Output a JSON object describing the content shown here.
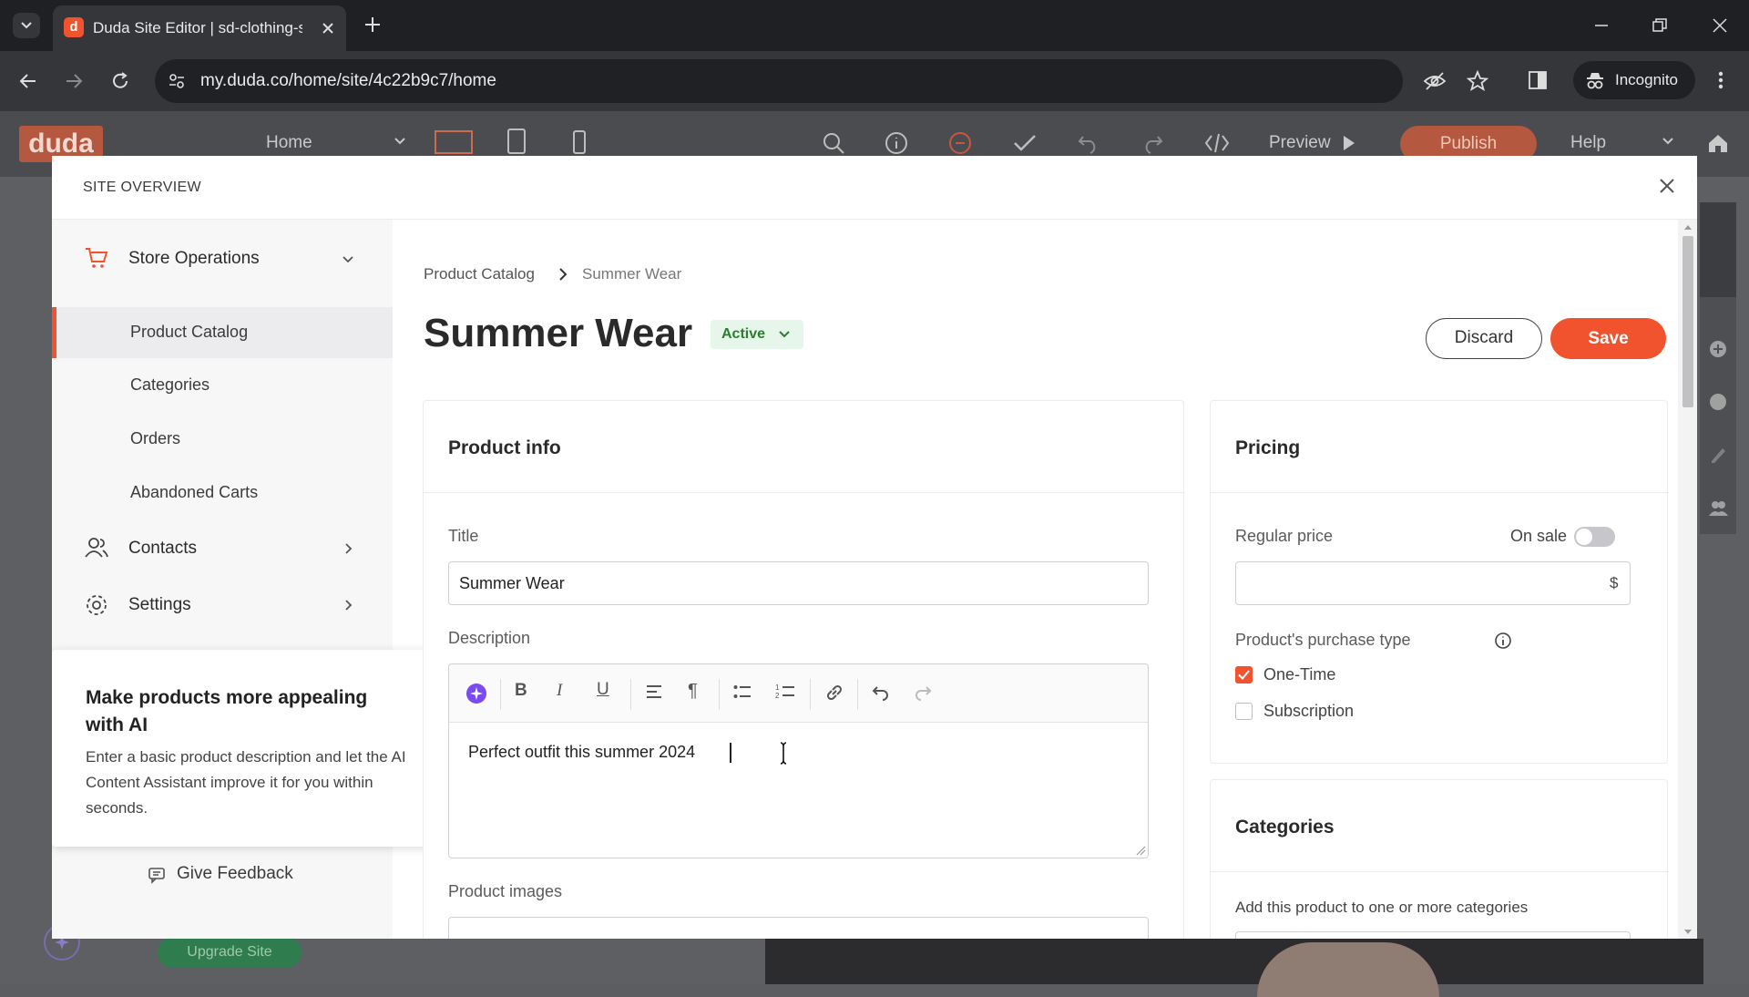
{
  "browser": {
    "tab_title": "Duda Site Editor | sd-clothing-s",
    "url": "my.duda.co/home/site/4c22b9c7/home",
    "profile_label": "Incognito"
  },
  "duda": {
    "logo": "duda",
    "page_select": "Home",
    "preview_label": "Preview",
    "publish_label": "Publish",
    "help_label": "Help",
    "upgrade_label": "Upgrade Site"
  },
  "modal": {
    "header": "SITE OVERVIEW"
  },
  "sidebar": {
    "section_label": "Store Operations",
    "sub_items": [
      "Product Catalog",
      "Categories",
      "Orders",
      "Abandoned Carts"
    ],
    "contacts_label": "Contacts",
    "settings_label": "Settings",
    "feedback_label": "Give Feedback"
  },
  "ai_tip": {
    "title": "Make products more appealing with AI",
    "body": "Enter a basic product description and let the AI Content Assistant improve it for you within seconds."
  },
  "breadcrumb": {
    "parent": "Product Catalog",
    "current": "Summer Wear"
  },
  "product": {
    "heading": "Summer Wear",
    "status": "Active",
    "discard_label": "Discard",
    "save_label": "Save"
  },
  "product_info": {
    "card_title": "Product info",
    "title_label": "Title",
    "title_value": "Summer Wear",
    "description_label": "Description",
    "description_value": "Perfect outfit this summer 2024",
    "images_label": "Product images"
  },
  "pricing": {
    "card_title": "Pricing",
    "regular_price_label": "Regular price",
    "on_sale_label": "On sale",
    "currency_symbol": "$",
    "purchase_type_label": "Product's purchase type",
    "option_one_time": "One-Time",
    "option_subscription": "Subscription"
  },
  "categories": {
    "card_title": "Categories",
    "helper": "Add this product to one or more categories"
  },
  "colors": {
    "accent": "#f0532d",
    "active_badge_bg": "#e6f6ea",
    "active_badge_text": "#2e7d32",
    "ai_purple": "#7b4bf0"
  }
}
